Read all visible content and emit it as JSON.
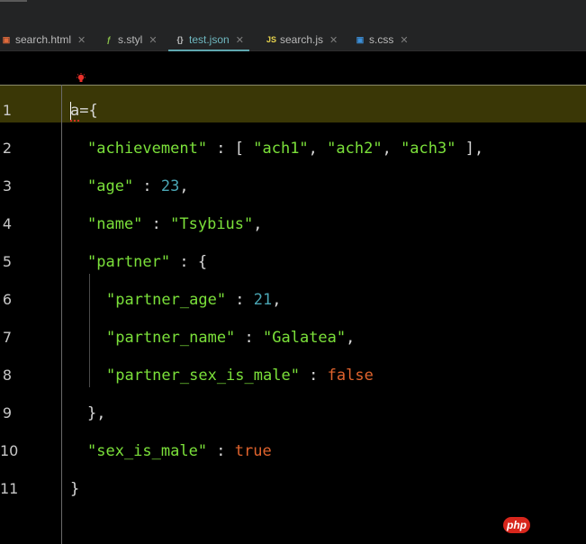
{
  "tabs": [
    {
      "label": "search.html",
      "icon": "html-file-icon",
      "glyph": "▣",
      "color": "#e06a3c",
      "active": false
    },
    {
      "label": "s.styl",
      "icon": "stylus-file-icon",
      "glyph": "ƒ",
      "color": "#8bc34a",
      "active": false
    },
    {
      "label": "test.json",
      "icon": "json-file-icon",
      "glyph": "{}",
      "color": "#c0c0c0",
      "active": true
    },
    {
      "label": "search.js",
      "icon": "js-file-icon",
      "glyph": "JS",
      "color": "#e8d44d",
      "active": false
    },
    {
      "label": "s.css",
      "icon": "css-file-icon",
      "glyph": "▣",
      "color": "#3c8fd8",
      "active": false
    }
  ],
  "close_glyph": "✕",
  "editor": {
    "line_numbers": [
      "1",
      "2",
      "3",
      "4",
      "5",
      "6",
      "7",
      "8",
      "9",
      "10",
      "11"
    ],
    "lines": {
      "l1": {
        "var": "a",
        "rest": "={"
      },
      "l2": {
        "key": "\"achievement\"",
        "sep": " : [ ",
        "v1": "\"ach1\"",
        "c1": ", ",
        "v2": "\"ach2\"",
        "c2": ", ",
        "v3": "\"ach3\"",
        "end": " ],"
      },
      "l3": {
        "key": "\"age\"",
        "sep": " : ",
        "val": "23",
        "end": ","
      },
      "l4": {
        "key": "\"name\"",
        "sep": " : ",
        "val": "\"Tsybius\"",
        "end": ","
      },
      "l5": {
        "key": "\"partner\"",
        "sep": " : {"
      },
      "l6": {
        "key": "\"partner_age\"",
        "sep": " : ",
        "val": "21",
        "end": ","
      },
      "l7": {
        "key": "\"partner_name\"",
        "sep": " : ",
        "val": "\"Galatea\"",
        "end": ","
      },
      "l8": {
        "key": "\"partner_sex_is_male\"",
        "sep": " : ",
        "val": "false"
      },
      "l9": {
        "text": "},"
      },
      "l10": {
        "key": "\"sex_is_male\"",
        "sep": " : ",
        "val": "true"
      },
      "l11": {
        "text": "}"
      }
    }
  },
  "watermark": "php",
  "colors": {
    "key": "#7be03a",
    "number": "#4aa6b4",
    "boolean": "#e0632d",
    "current_line": "#3a3706",
    "active_tab": "#6fb8c0"
  }
}
